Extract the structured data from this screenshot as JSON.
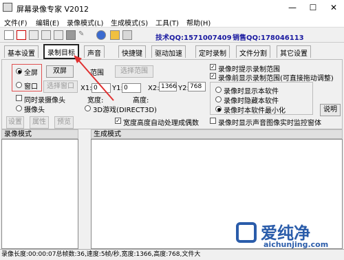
{
  "window": {
    "title": "屏幕录像专家 V2012"
  },
  "menu": [
    "文件(F)",
    "编辑(E)",
    "录像模式(L)",
    "生成模式(S)",
    "工具(T)",
    "帮助(H)"
  ],
  "toolbar": {
    "qq_tech": "技术QQ:1571007409",
    "qq_sales": "销售QQ:178046113"
  },
  "tabs": [
    "基本设置",
    "录制目标",
    "声音",
    "快捷键",
    "驱动加速",
    "定时录制",
    "文件分割",
    "其它设置"
  ],
  "target": {
    "fullscreen": "全屏",
    "window": "窗口",
    "dual_screen": "双屏",
    "select_window": "选择窗口",
    "range": "范围",
    "select_range": "选择范围",
    "x1_label": "X1:",
    "x1": "0",
    "y1_label": "Y1:",
    "y1": "0",
    "x2_label": "X2:",
    "x2": "1366",
    "y2_label": "Y2:",
    "y2": "768",
    "width_label": "宽度:",
    "height_label": "高度:",
    "record_camera": "同时录摄像头",
    "camera": "摄像头",
    "game_3d": "3D游戏(DIRECT3D)",
    "settings": "设置",
    "properties": "属性",
    "preview": "预览",
    "auto_odd": "宽度高度自动处理成偶数",
    "hint_range": "录像时提示录制范围",
    "show_range_before": "录像前显示录制范围(可直接拖动调整)",
    "show_software": "录像时显示本软件",
    "hide_software": "录像时隐藏本软件",
    "minimize_software": "录像时本软件最小化",
    "explain": "说明",
    "monitor_window": "录像时显示声音图像实时监控窗体"
  },
  "sections": {
    "record_mode": "录像模式",
    "generate_mode": "生成模式"
  },
  "status": "录像长度:00:00:07总帧数:36,速度:5帧/秒,宽度:1366,高度:768,文件大",
  "watermark": {
    "brand": "爱纯净",
    "url": "aichunjing.com"
  }
}
